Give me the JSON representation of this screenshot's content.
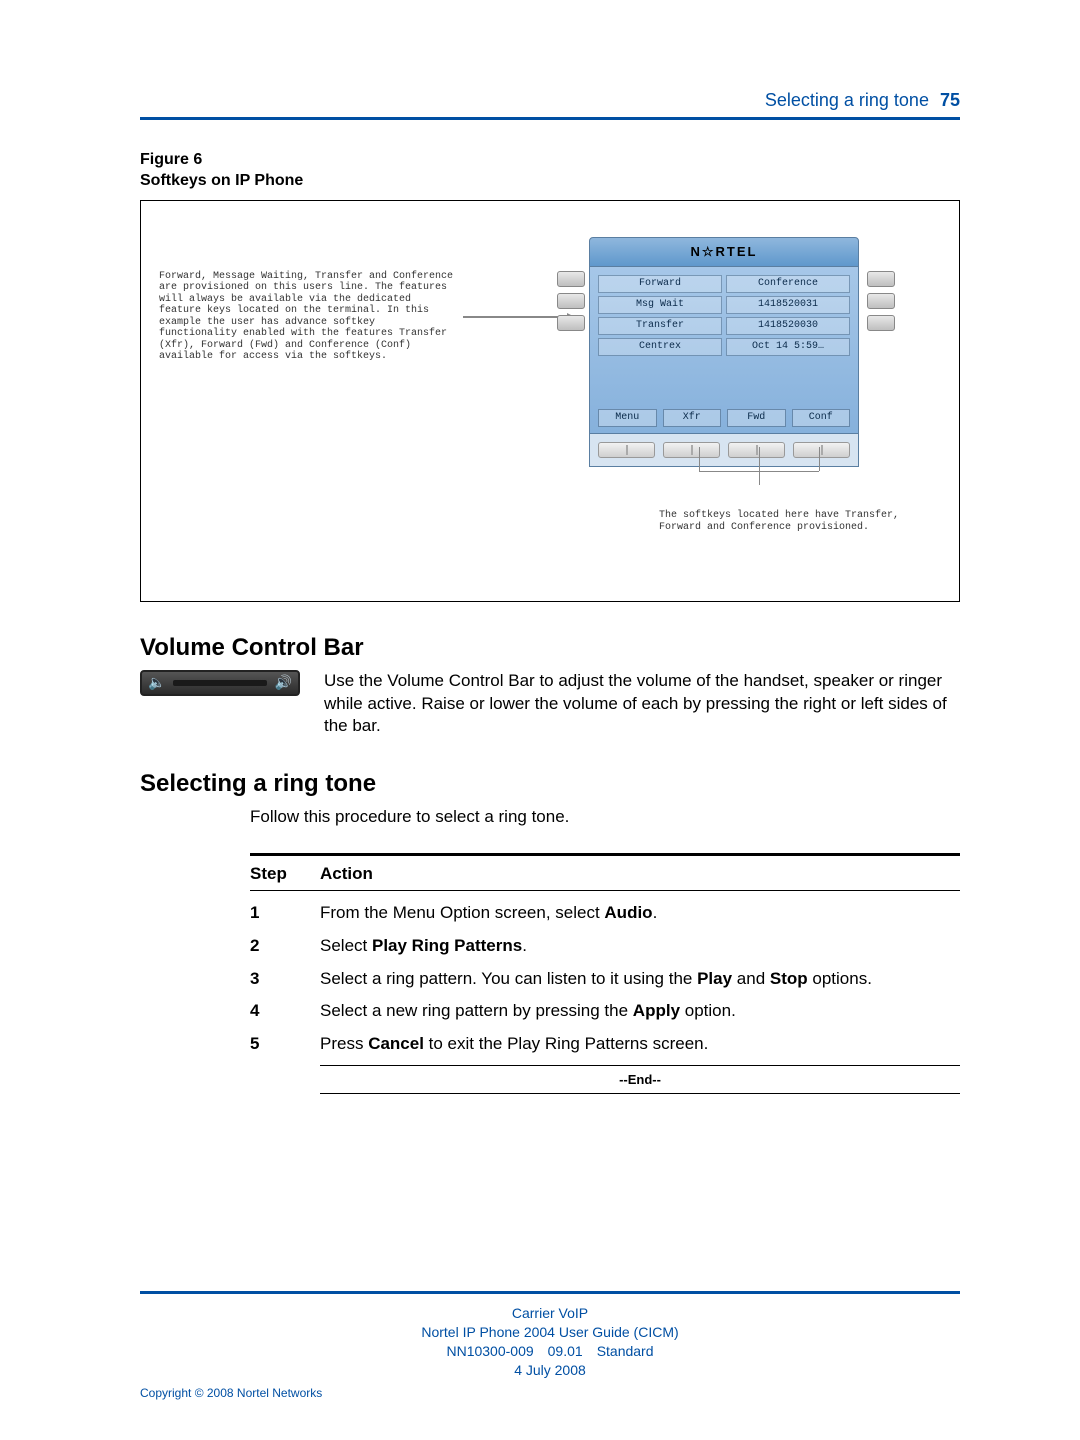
{
  "header": {
    "title": "Selecting a ring tone",
    "page_number": "75"
  },
  "figure": {
    "label_line1": "Figure 6",
    "label_line2": "Softkeys on IP Phone",
    "left_note": "Forward, Message Waiting, Transfer and Conference are provisioned on this users line.  The features will always be available via the dedicated feature keys located on the terminal.  In this example the user has advance softkey functionality enabled with the features Transfer (Xfr), Forward (Fwd) and Conference (Conf) available for access via the softkeys.",
    "brand": "N☆RTEL",
    "screen_rows": [
      [
        "Forward",
        "Conference"
      ],
      [
        "Msg Wait",
        "1418520031"
      ],
      [
        "Transfer",
        "1418520030"
      ],
      [
        "Centrex",
        "Oct 14 5:59…"
      ]
    ],
    "softkeys": [
      "Menu",
      "Xfr",
      "Fwd",
      "Conf"
    ],
    "bottom_note": "The softkeys located here have Transfer, Forward and Conference provisioned."
  },
  "volume": {
    "heading": "Volume Control Bar",
    "text": "Use the Volume Control Bar to adjust the volume of the handset, speaker or ringer while active. Raise or lower the volume of each by pressing the right or left sides of the bar."
  },
  "ringtone": {
    "heading": "Selecting a ring tone",
    "intro": "Follow this procedure to select a ring tone.",
    "col_step": "Step",
    "col_action": "Action",
    "steps": [
      {
        "n": "1",
        "pre": "From the Menu Option screen, select ",
        "b1": "Audio",
        "post": "."
      },
      {
        "n": "2",
        "pre": "Select ",
        "b1": "Play Ring Patterns",
        "post": "."
      },
      {
        "n": "3",
        "pre": "Select a ring pattern. You can listen to it using the ",
        "b1": "Play",
        "mid": " and ",
        "b2": "Stop",
        "post": " options."
      },
      {
        "n": "4",
        "pre": "Select a new ring pattern by pressing the ",
        "b1": "Apply",
        "post": " option."
      },
      {
        "n": "5",
        "pre": "Press ",
        "b1": "Cancel",
        "post": " to exit the Play Ring Patterns screen."
      }
    ],
    "end": "--End--"
  },
  "footer": {
    "line1": "Carrier VoIP",
    "line2": "Nortel IP Phone 2004 User Guide (CICM)",
    "line3a": "NN10300-009",
    "line3b": "09.01",
    "line3c": "Standard",
    "line4": "4 July 2008",
    "copyright": "Copyright © 2008 Nortel Networks"
  }
}
